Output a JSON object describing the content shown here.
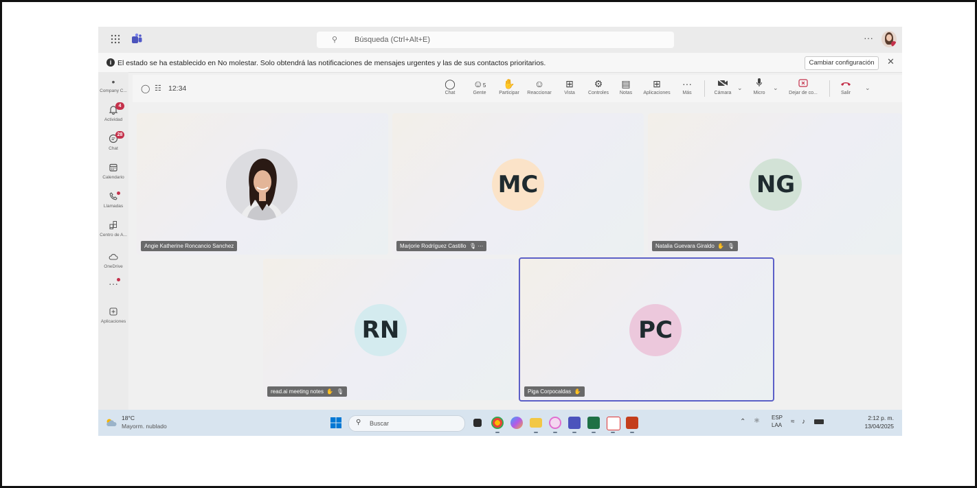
{
  "app": {
    "search_placeholder": "Búsqueda (Ctrl+Alt+E)",
    "more": "···"
  },
  "notification": {
    "message": "El estado se ha establecido en No molestar. Solo obtendrá las notificaciones de mensajes urgentes y las de sus contactos prioritarios.",
    "button": "Cambiar configuración",
    "close": "✕"
  },
  "rail": {
    "items": [
      {
        "label": "Company C...",
        "icon": "company-icon"
      },
      {
        "label": "Actividad",
        "icon": "bell-icon",
        "badge": "4"
      },
      {
        "label": "Chat",
        "icon": "chat-icon",
        "badge": "28"
      },
      {
        "label": "Calendario",
        "icon": "calendar-icon"
      },
      {
        "label": "Llamadas",
        "icon": "phone-icon"
      },
      {
        "label": "Centro de A...",
        "icon": "apps-center-icon"
      },
      {
        "label": "OneDrive",
        "icon": "cloud-icon"
      },
      {
        "label": "",
        "icon": "more-icon"
      },
      {
        "label": "Aplicaciones",
        "icon": "add-app-icon"
      }
    ]
  },
  "meeting": {
    "time": "12:34",
    "controls": [
      {
        "label": "Chat",
        "icon": "chat-icon"
      },
      {
        "label": "Gente",
        "icon": "people-icon",
        "count": "5"
      },
      {
        "label": "Participar",
        "icon": "raise-hand-icon"
      },
      {
        "label": "Reaccionar",
        "icon": "smile-icon"
      },
      {
        "label": "Vista",
        "icon": "view-icon"
      },
      {
        "label": "Controles",
        "icon": "controls-icon"
      },
      {
        "label": "Notas",
        "icon": "notes-icon"
      },
      {
        "label": "Aplicaciones",
        "icon": "add-app-icon"
      },
      {
        "label": "Más",
        "icon": "more-icon"
      },
      {
        "label": "Cámara",
        "icon": "camera-off-icon"
      },
      {
        "label": "Micro",
        "icon": "mic-icon"
      },
      {
        "label": "Dejar de co...",
        "icon": "stop-share-icon"
      },
      {
        "label": "Salir",
        "icon": "hangup-icon"
      }
    ]
  },
  "participants": [
    {
      "name": "Angie Katherine Roncancio Sanchez",
      "initials": "",
      "color": ""
    },
    {
      "name": "Marjorie Rodríguez Castillo",
      "initials": "MC",
      "color": "#fbe3c8",
      "extra": "···"
    },
    {
      "name": "Natalia Guevara Giraldo",
      "initials": "NG",
      "color": "#d2e2d6"
    },
    {
      "name": "read.ai meeting notes",
      "initials": "RN",
      "color": "#d4ebef"
    },
    {
      "name": "Piga Corpocaldas",
      "initials": "PC",
      "color": "#ecc8dc"
    }
  ],
  "taskbar": {
    "temp": "18°C",
    "weather": "Mayorm. nublado",
    "search": "Buscar",
    "lang1": "ESP",
    "lang2": "LAA",
    "time": "2:12 p. m.",
    "date": "13/04/2025"
  },
  "colors": {
    "accent": "#5b5fc7",
    "badge": "#c4314b",
    "leave": "#c4314b"
  }
}
